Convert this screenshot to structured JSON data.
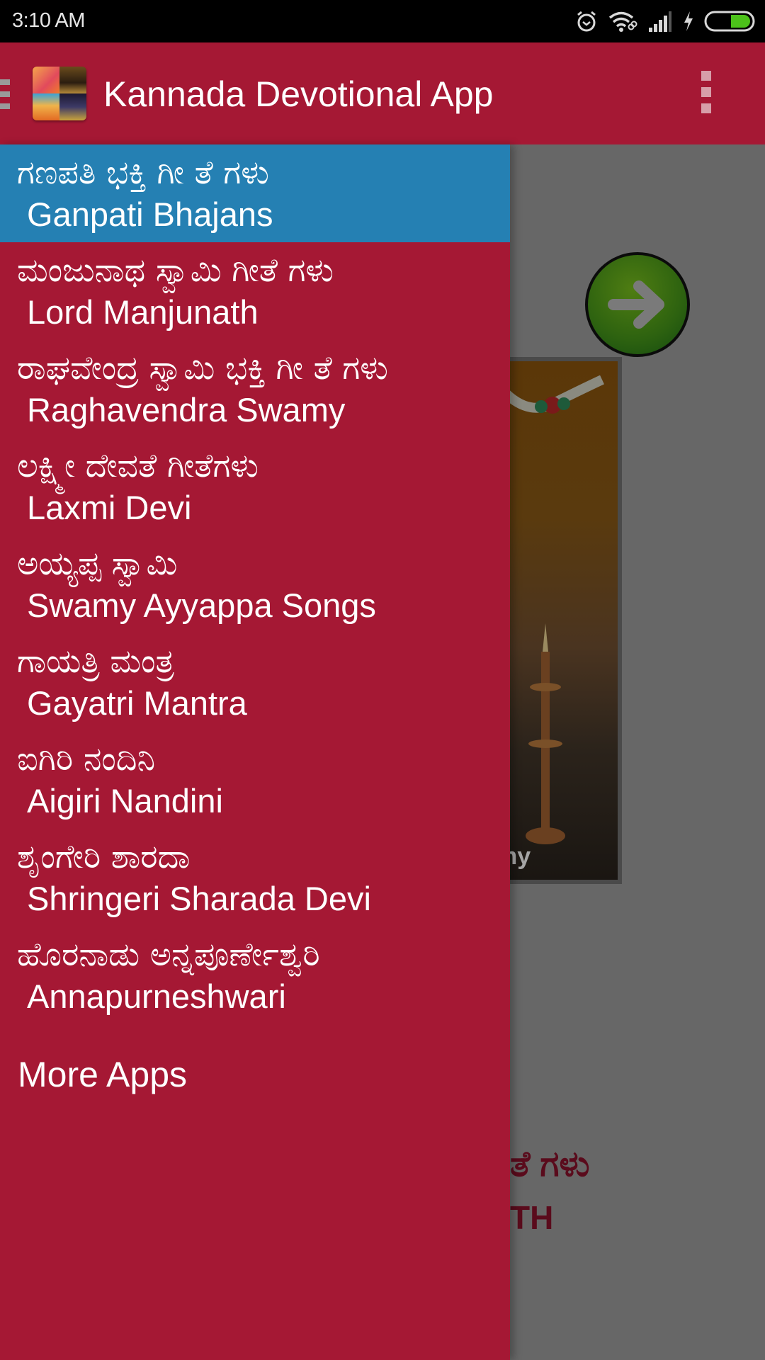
{
  "status_bar": {
    "time": "3:10 AM",
    "icons": [
      "alarm-icon",
      "wifi-icon",
      "signal-icon",
      "charging-icon",
      "battery-icon"
    ],
    "battery_color": "#4cc21a"
  },
  "app_bar": {
    "title": "Kannada Devotional App",
    "background_color": "#a51834"
  },
  "drawer": {
    "background_color": "#a51834",
    "selected_color": "#2580b3",
    "items": [
      {
        "kannada": "ಗಣಪತಿ ಭಕ್ತಿ ಗೀ ತೆ ಗಳು",
        "english": "Ganpati Bhajans",
        "selected": true
      },
      {
        "kannada": "ಮಂಜುನಾಥ ಸ್ವಾಮಿ ಗೀತೆ ಗಳು",
        "english": "Lord Manjunath",
        "selected": false
      },
      {
        "kannada": "ರಾಘವೇಂದ್ರ ಸ್ವಾಮಿ ಭಕ್ತಿ ಗೀ ತೆ ಗಳು",
        "english": "Raghavendra Swamy",
        "selected": false
      },
      {
        "kannada": "ಲಕ್ಷ್ಮೀ ದೇವತೆ ಗೀತೆಗಳು",
        "english": "Laxmi Devi",
        "selected": false
      },
      {
        "kannada": "ಅಯ್ಯಪ್ಪ ಸ್ವಾಮಿ",
        "english": "Swamy Ayyappa Songs",
        "selected": false
      },
      {
        "kannada": "ಗಾಯತ್ರಿ ಮಂತ್ರ",
        "english": "Gayatri Mantra",
        "selected": false
      },
      {
        "kannada": "ಐಗಿರಿ ನಂದಿನಿ",
        "english": "Aigiri Nandini",
        "selected": false
      },
      {
        "kannada": "ಶೃಂಗೇರಿ ಶಾರದಾ",
        "english": "Shringeri Sharada Devi",
        "selected": false
      },
      {
        "kannada": "ಹೊರನಾಡು ಅನ್ನಪೂರ್ಣೇಶ್ವರಿ",
        "english": "Annapurneshwari",
        "selected": false
      }
    ],
    "more_apps": "More Apps"
  },
  "background_content": {
    "banner_caption_fragment": "my",
    "title_kannada_fragment": "ತೆ ಗಳು",
    "title_english_fragment": "TH"
  }
}
